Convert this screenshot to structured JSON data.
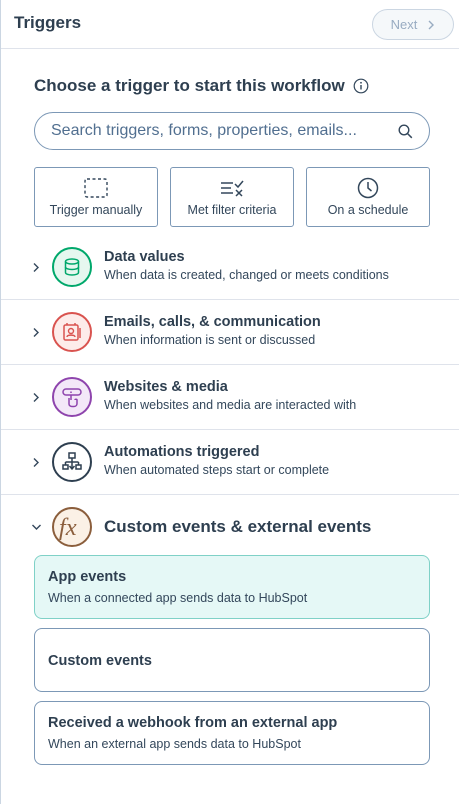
{
  "header": {
    "title": "Triggers",
    "next_label": "Next"
  },
  "main": {
    "title": "Choose a trigger to start this workflow",
    "search": {
      "placeholder": "Search triggers, forms, properties, emails..."
    },
    "quick_triggers": [
      {
        "label": "Trigger manually",
        "icon": "dashed-square-icon"
      },
      {
        "label": "Met filter criteria",
        "icon": "filter-check-icon"
      },
      {
        "label": "On a schedule",
        "icon": "clock-icon"
      }
    ],
    "categories": [
      {
        "title": "Data values",
        "description": "When data is created, changed or meets conditions",
        "icon": "database-icon",
        "color": "#00a86b"
      },
      {
        "title": "Emails, calls, & communication",
        "description": "When information is sent or discussed",
        "icon": "contact-card-icon",
        "color": "#d9534f"
      },
      {
        "title": "Websites & media",
        "description": "When websites and media are interacted with",
        "icon": "website-click-icon",
        "color": "#8e44ad"
      },
      {
        "title": "Automations triggered",
        "description": "When automated steps start or complete",
        "icon": "workflow-icon",
        "color": "#2e3f50"
      }
    ],
    "expanded_category": {
      "title": "Custom events & external events",
      "icon": "fx-icon",
      "color": "#8b5e3c",
      "options": [
        {
          "title": "App events",
          "description": "When a connected app sends data to HubSpot",
          "selected": true
        },
        {
          "title": "Custom events",
          "description": ""
        },
        {
          "title": "Received a webhook from an external app",
          "description": "When an external app sends data to HubSpot"
        }
      ]
    }
  }
}
